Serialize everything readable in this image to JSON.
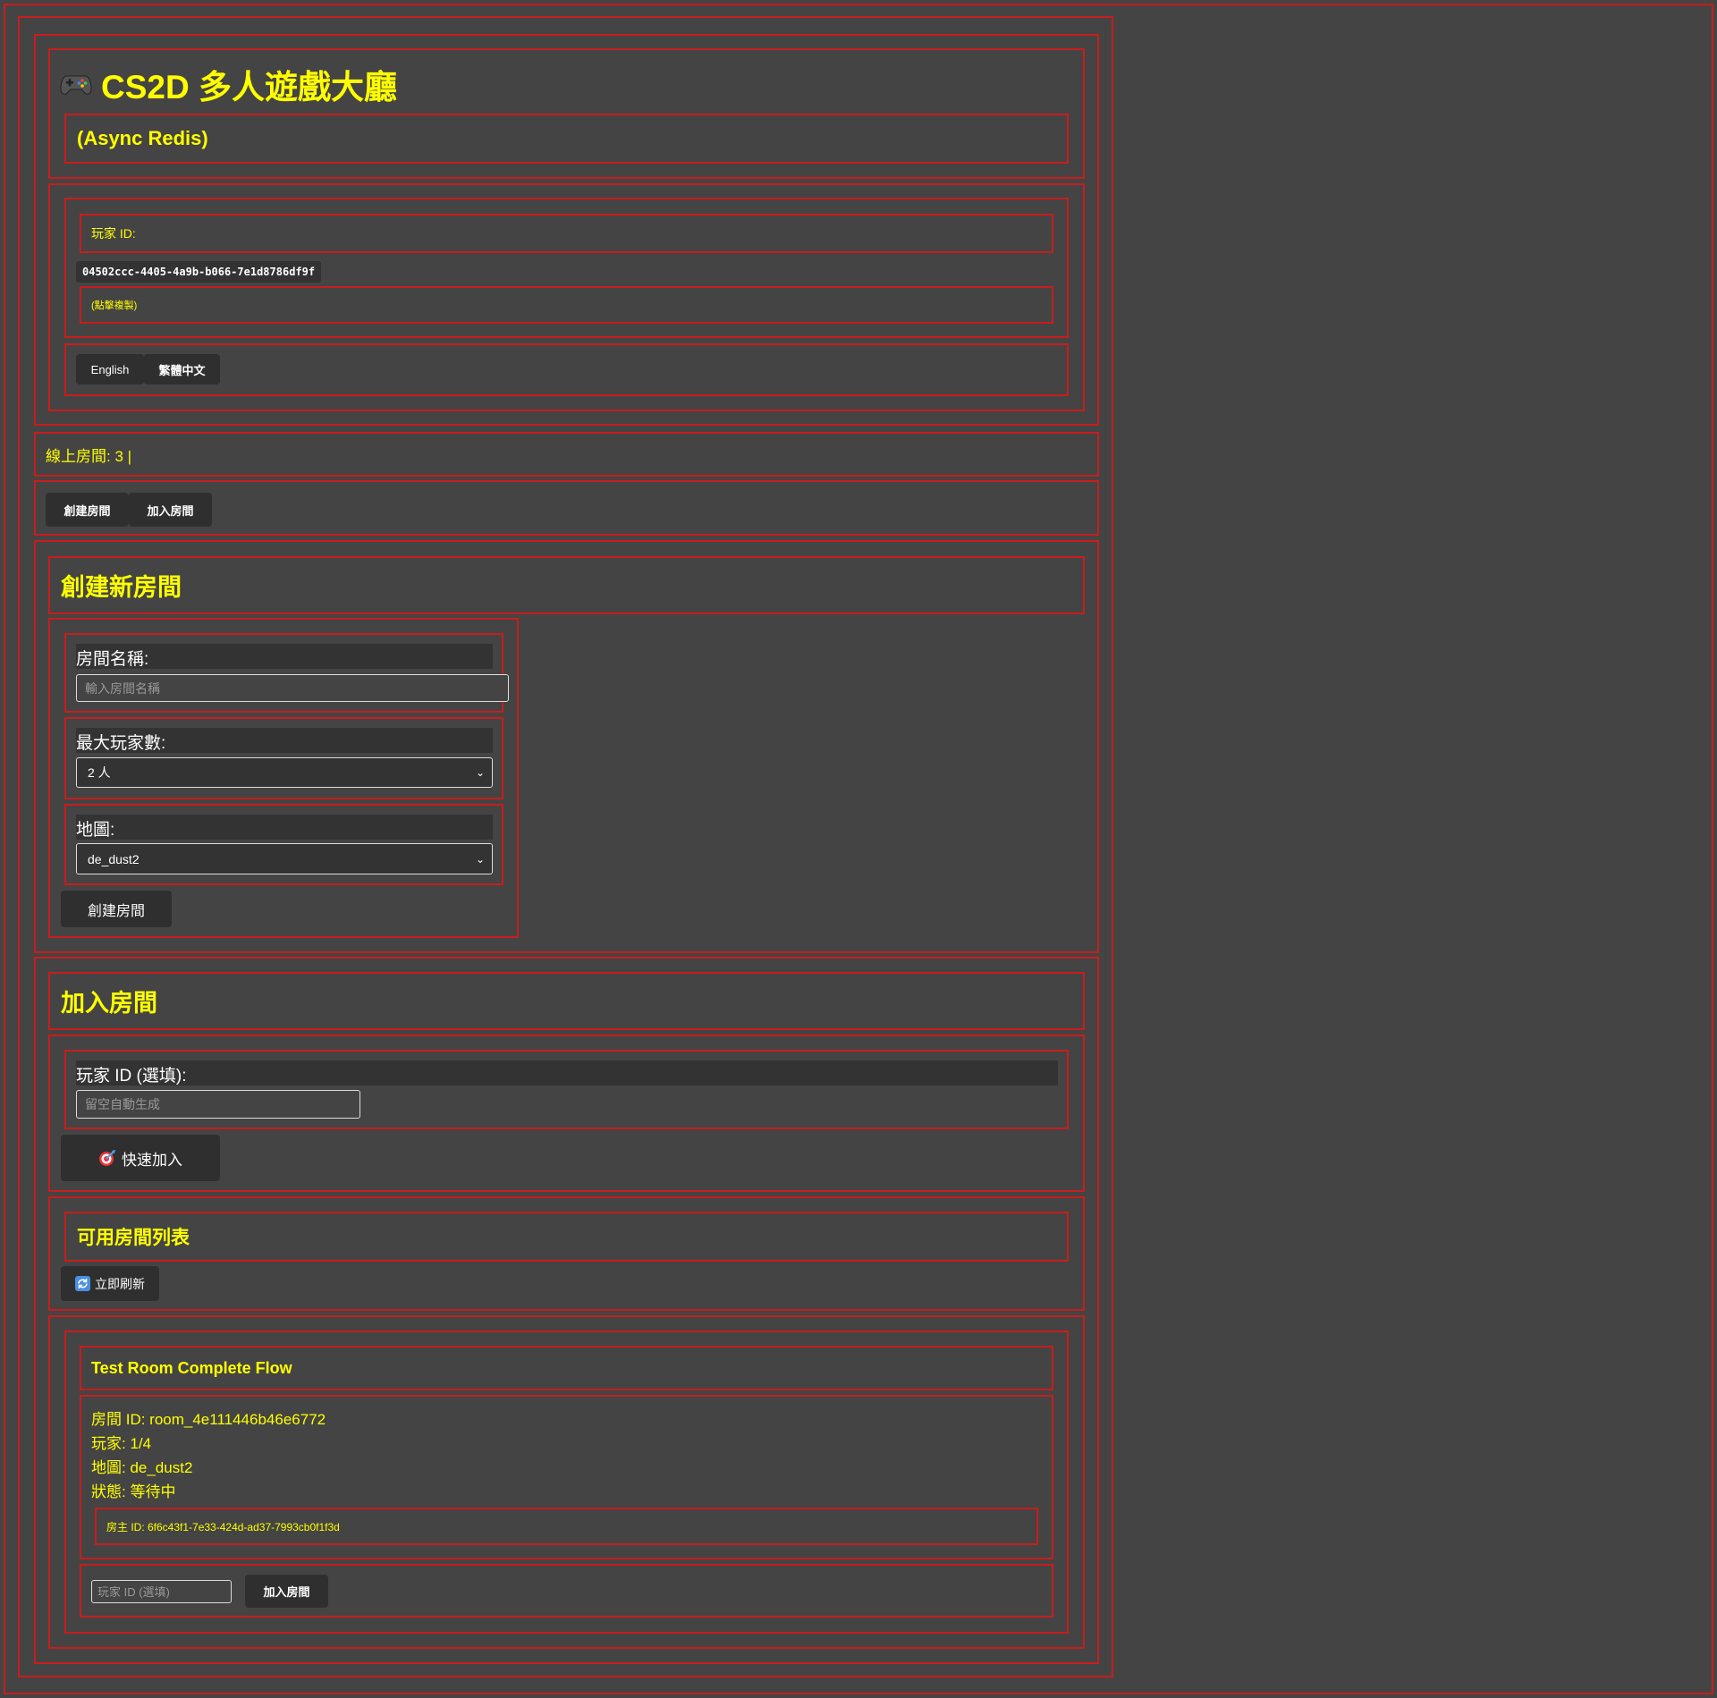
{
  "header": {
    "title": "CS2D 多人遊戲大廳",
    "subtitle": "(Async Redis)",
    "player_id_label": "玩家 ID:",
    "player_id_value": "04502ccc-4405-4a9b-b066-7e1d8786df9f",
    "copy_hint": "(點擊複製)",
    "languages": [
      "English",
      "繁體中文"
    ]
  },
  "status": {
    "online_rooms": "線上房間: 3 |"
  },
  "tabs": [
    "創建房間",
    "加入房間"
  ],
  "create_room": {
    "heading": "創建新房間",
    "room_name_label": "房間名稱:",
    "room_name_placeholder": "輸入房間名稱",
    "max_players_label": "最大玩家數:",
    "max_players_value": "2 人",
    "map_label": "地圖:",
    "map_value": "de_dust2",
    "submit_label": "創建房間"
  },
  "join_room": {
    "heading": "加入房間",
    "player_id_label": "玩家 ID (選填):",
    "player_id_placeholder": "留空自動生成",
    "quick_join_label": "快速加入",
    "room_list_heading": "可用房間列表",
    "refresh_label": "立即刷新"
  },
  "rooms": [
    {
      "name": "Test Room Complete Flow",
      "room_id": "房間 ID: room_4e111446b46e6772",
      "players": "玩家: 1/4",
      "map": "地圖: de_dust2",
      "status": "狀態: 等待中",
      "host": "房主 ID: 6f6c43f1-7e33-424d-ad37-7993cb0f1f3d",
      "player_input_placeholder": "玩家 ID (選填)",
      "join_label": "加入房間"
    }
  ],
  "colors": {
    "accent": "#ffff00",
    "border": "#c81d1d",
    "background": "#444444",
    "button": "#2f2f2f"
  },
  "icons": [
    "gamepad-icon",
    "target-icon",
    "refresh-icon"
  ]
}
